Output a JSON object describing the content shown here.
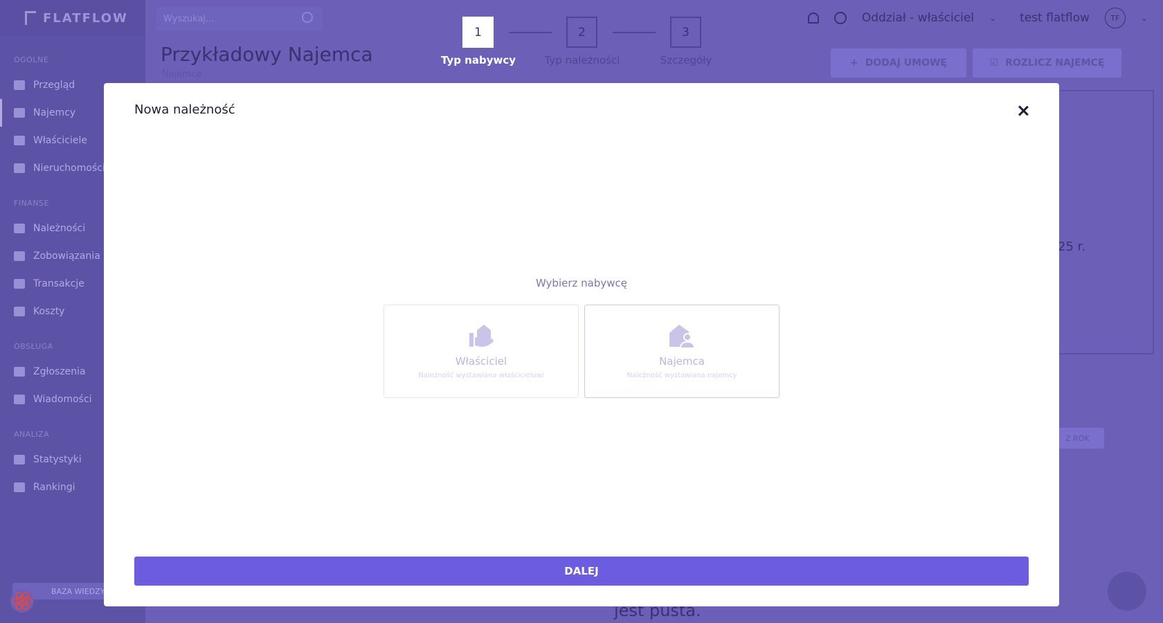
{
  "app": {
    "logo_text": "FLATFLOW",
    "search_placeholder": "Wyszukaj...",
    "branch": "Oddział - właściciel",
    "user_name": "test flatflow",
    "avatar_initials": "TF"
  },
  "sidebar": {
    "sections": [
      {
        "title": "OGÓLNE",
        "items": [
          {
            "label": "Przegląd"
          },
          {
            "label": "Najemcy"
          },
          {
            "label": "Właściciele"
          },
          {
            "label": "Nieruchomości"
          }
        ]
      },
      {
        "title": "FINANSE",
        "items": [
          {
            "label": "Należności"
          },
          {
            "label": "Zobowiązania"
          },
          {
            "label": "Transakcje"
          },
          {
            "label": "Koszty"
          }
        ]
      },
      {
        "title": "OBSŁUGA",
        "items": [
          {
            "label": "Zgłoszenia"
          },
          {
            "label": "Wiadomości"
          }
        ]
      },
      {
        "title": "ANALIZA",
        "items": [
          {
            "label": "Statystyki"
          },
          {
            "label": "Rankingi"
          }
        ]
      }
    ],
    "knowledge_base": "BAZA WIEDZY"
  },
  "page": {
    "title": "Przykładowy Najemca",
    "subtitle": "Najemca",
    "add_contract": "DODAJ UMOWĘ",
    "settle_tenant": "ROZLICZ NAJEMCĘ",
    "date_fragment": "25 r.",
    "year_filter": "Z ROK",
    "empty_fragment": "jest pusta."
  },
  "stepper": {
    "steps": [
      {
        "number": "1",
        "label": "Typ nabywcy",
        "current": true
      },
      {
        "number": "2",
        "label": "Typ należności",
        "current": false
      },
      {
        "number": "3",
        "label": "Szczegóły",
        "current": false
      }
    ]
  },
  "modal": {
    "title": "Nowa należność",
    "choose_label": "Wybierz nabywcę",
    "options": [
      {
        "title": "Właściciel",
        "description": "Należność wystawiana właścicielowi",
        "icon": "owner-icon"
      },
      {
        "title": "Najemca",
        "description": "Należność wystawiana najemcy",
        "icon": "tenant-icon"
      }
    ],
    "next_button": "DALEJ"
  },
  "colors": {
    "accent": "#6c5ce0",
    "overlay": "#6b5fb8",
    "modal_bg": "#ffffff"
  }
}
